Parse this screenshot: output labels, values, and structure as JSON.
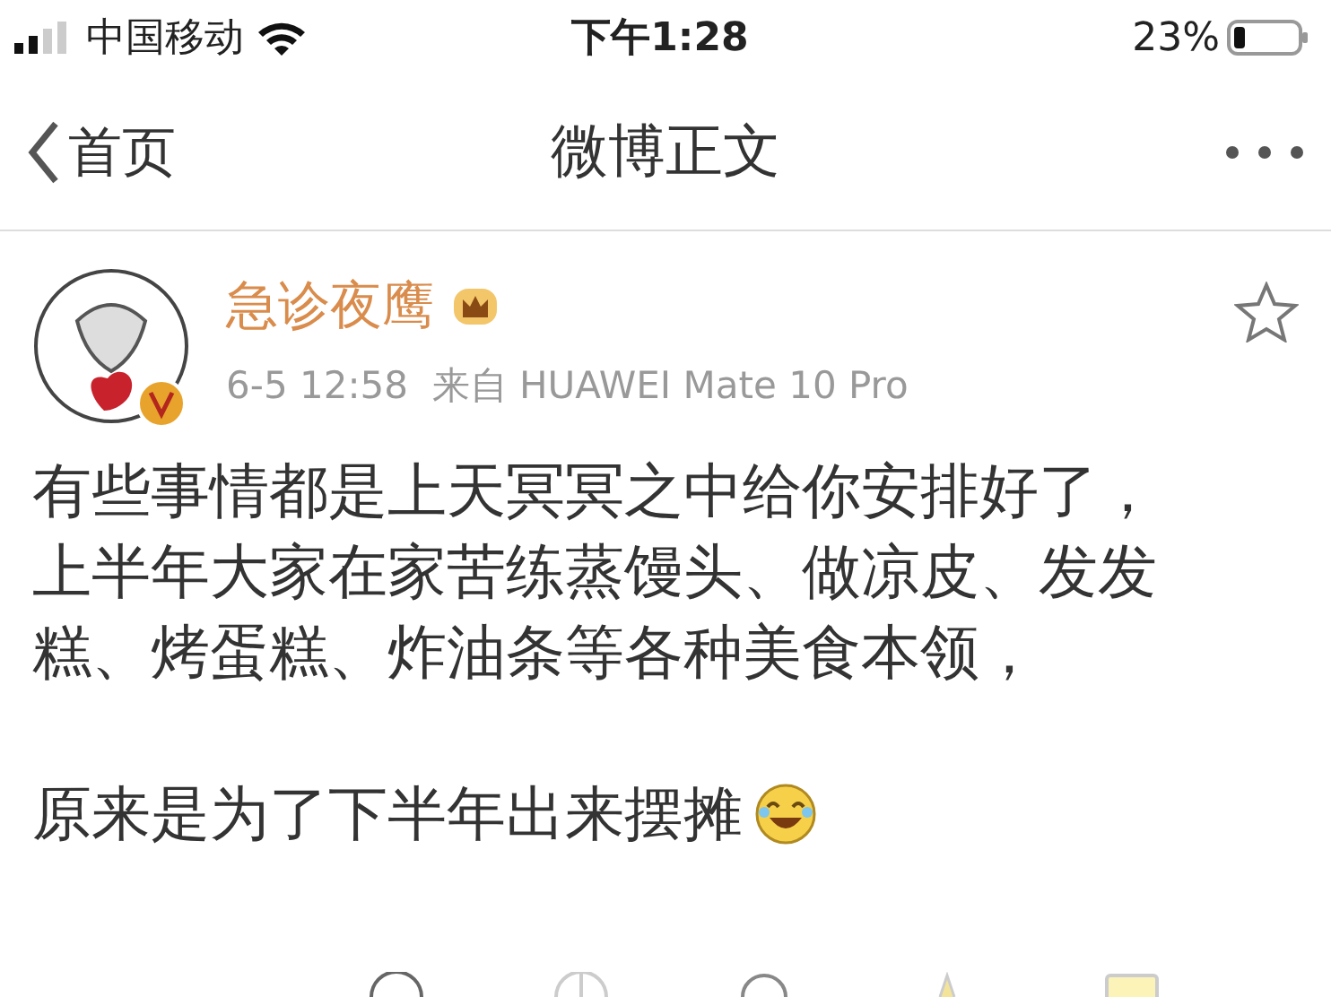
{
  "status_bar": {
    "carrier": "中国移动",
    "time": "下午1:28",
    "battery": "23%"
  },
  "nav": {
    "back": "首页",
    "title": "微博正文"
  },
  "post": {
    "author": "急诊夜鹰",
    "meta": "6-5 12:58  来自 HUAWEI Mate 10 Pro",
    "favorited": false,
    "paragraphs": [
      "有些事情都是上天冥冥之中给你安排好了，上半年大家在家苦练蒸馒头、做凉皮、发发糕、烤蛋糕、炸油条等各种美食本领，",
      "原来是为了下半年出来摆摊"
    ]
  }
}
